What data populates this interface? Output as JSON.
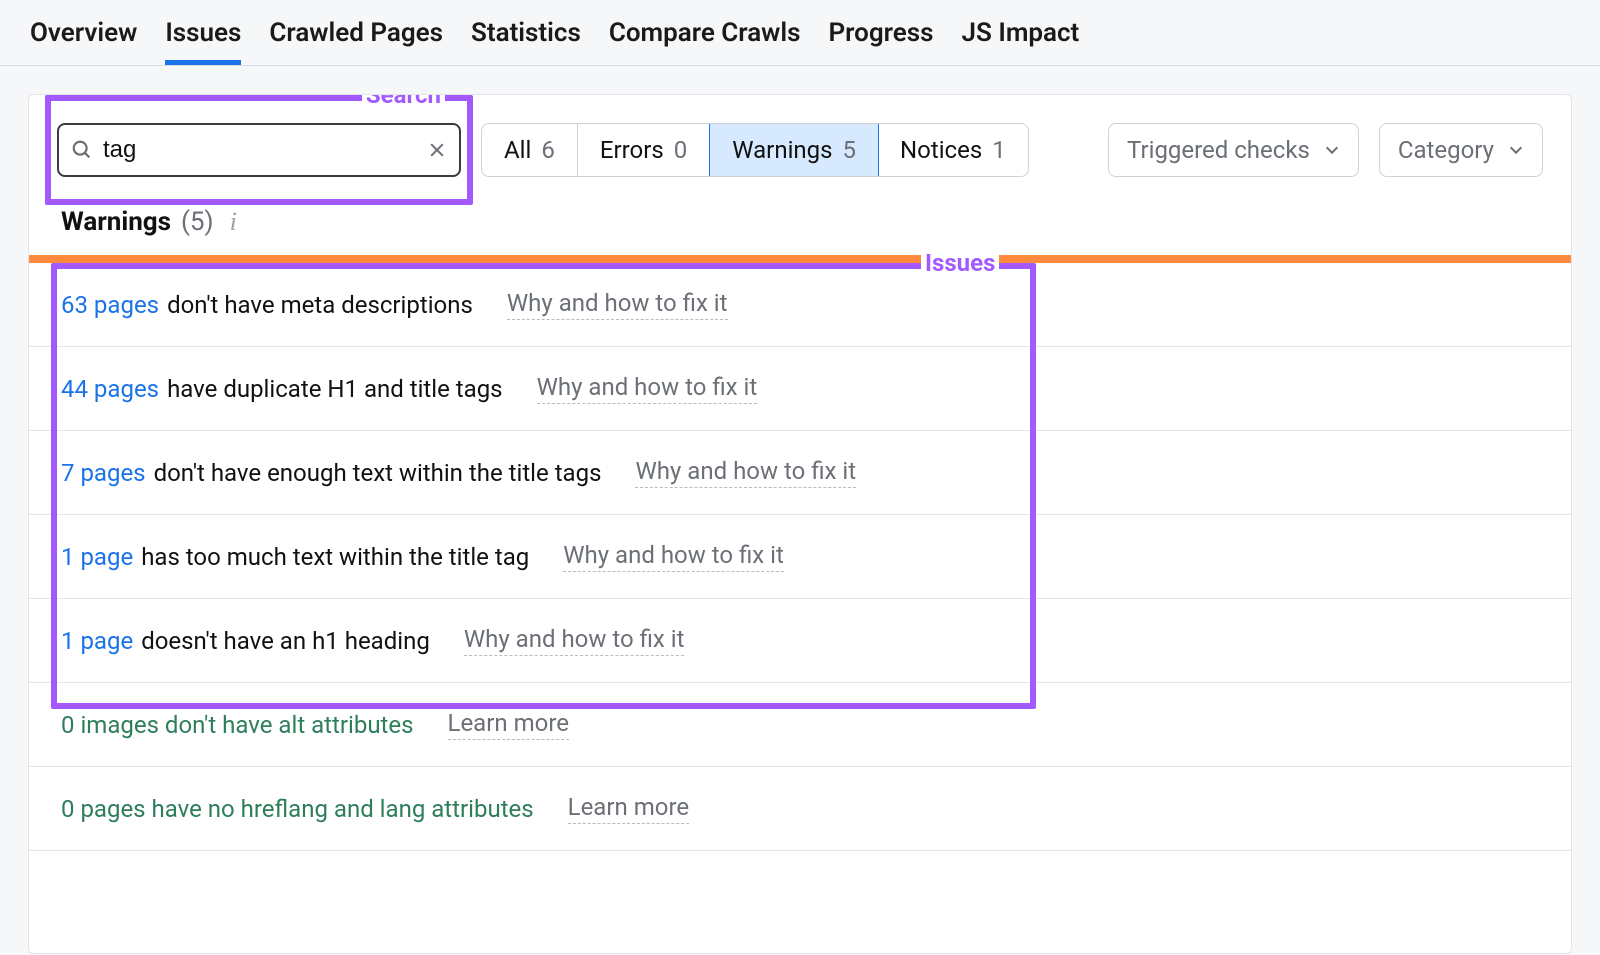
{
  "tabs": {
    "overview": "Overview",
    "issues": "Issues",
    "crawled": "Crawled Pages",
    "statistics": "Statistics",
    "compare": "Compare Crawls",
    "progress": "Progress",
    "jsimpact": "JS Impact"
  },
  "annotations": {
    "search": "Search",
    "issues": "Issues"
  },
  "search": {
    "value": "tag"
  },
  "filters": {
    "all": {
      "label": "All",
      "count": "6"
    },
    "errors": {
      "label": "Errors",
      "count": "0"
    },
    "warnings": {
      "label": "Warnings",
      "count": "5"
    },
    "notices": {
      "label": "Notices",
      "count": "1"
    }
  },
  "dropdowns": {
    "triggered": "Triggered checks",
    "category": "Category"
  },
  "section": {
    "title": "Warnings",
    "count": "(5)"
  },
  "rows": [
    {
      "link": "63 pages",
      "desc": "don't have meta descriptions",
      "hint": "Why and how to fix it"
    },
    {
      "link": "44 pages",
      "desc": "have duplicate H1 and title tags",
      "hint": "Why and how to fix it"
    },
    {
      "link": "7 pages",
      "desc": "don't have enough text within the title tags",
      "hint": "Why and how to fix it"
    },
    {
      "link": "1 page",
      "desc": "has too much text within the title tag",
      "hint": "Why and how to fix it"
    },
    {
      "link": "1 page",
      "desc": "doesn't have an h1 heading",
      "hint": "Why and how to fix it"
    }
  ],
  "passed": [
    {
      "text": "0 images don't have alt attributes",
      "hint": "Learn more"
    },
    {
      "text": "0 pages have no hreflang and lang attributes",
      "hint": "Learn more"
    }
  ]
}
